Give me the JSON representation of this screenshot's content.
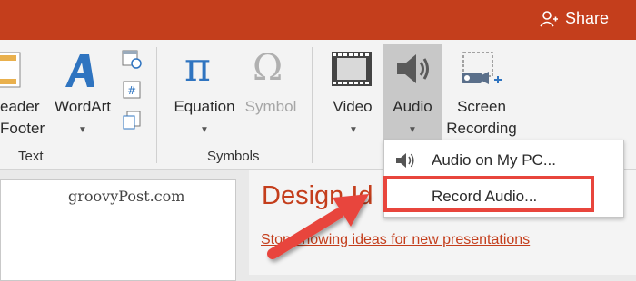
{
  "titlebar": {
    "share_label": "Share",
    "bg_color": "#c43e1c"
  },
  "ribbon": {
    "header_footer": {
      "label_line1": "eader",
      "label_line2": "Footer"
    },
    "wordart": {
      "label": "WordArt",
      "icon": "wordart-icon"
    },
    "text_group_label": "Text",
    "equation": {
      "label": "Equation",
      "icon": "pi-icon"
    },
    "symbol": {
      "label": "Symbol",
      "icon": "omega-icon"
    },
    "symbols_group_label": "Symbols",
    "video": {
      "label": "Video",
      "icon": "film-icon"
    },
    "audio": {
      "label": "Audio",
      "icon": "speaker-icon"
    },
    "screen_recording": {
      "label_line1": "Screen",
      "label_line2": "Recording",
      "icon": "screen-record-icon"
    },
    "small_icons": [
      "date-time-icon",
      "slide-number-icon",
      "object-icon"
    ]
  },
  "audio_menu": {
    "items": [
      {
        "label": "Audio on My PC...",
        "icon": "speaker-icon"
      },
      {
        "label": "Record Audio...",
        "highlight_color": "#e8453c"
      }
    ]
  },
  "slide": {
    "watermark": "groovyPost.com"
  },
  "design_pane": {
    "title": "Design Id",
    "stop_link": "Stop showing ideas for new presentations",
    "close": "×",
    "accent_color": "#c43e1c"
  }
}
